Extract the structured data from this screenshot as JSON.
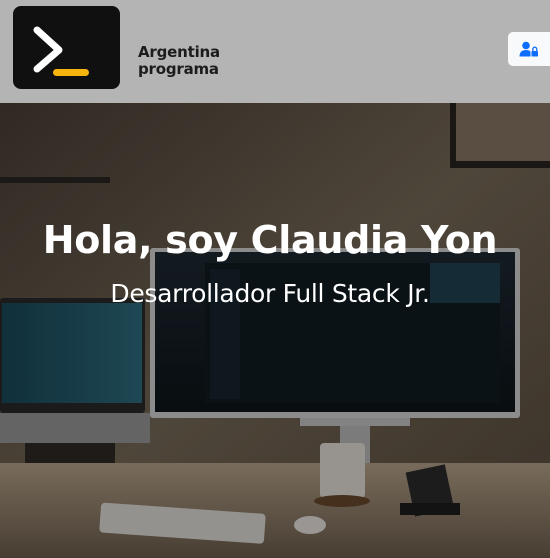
{
  "header": {
    "brand_line1": "Argentina",
    "brand_line2": "programa",
    "logo_icon": "terminal-prompt-icon",
    "user_button_icon": "user-lock-icon"
  },
  "hero": {
    "title": "Hola, soy Claudia Yon",
    "subtitle": "Desarrollador Full Stack Jr."
  },
  "colors": {
    "header_bg": "#b4b4b4",
    "logo_bg": "#101010",
    "logo_accent": "#f6b40e",
    "user_icon": "#0d6efd"
  }
}
